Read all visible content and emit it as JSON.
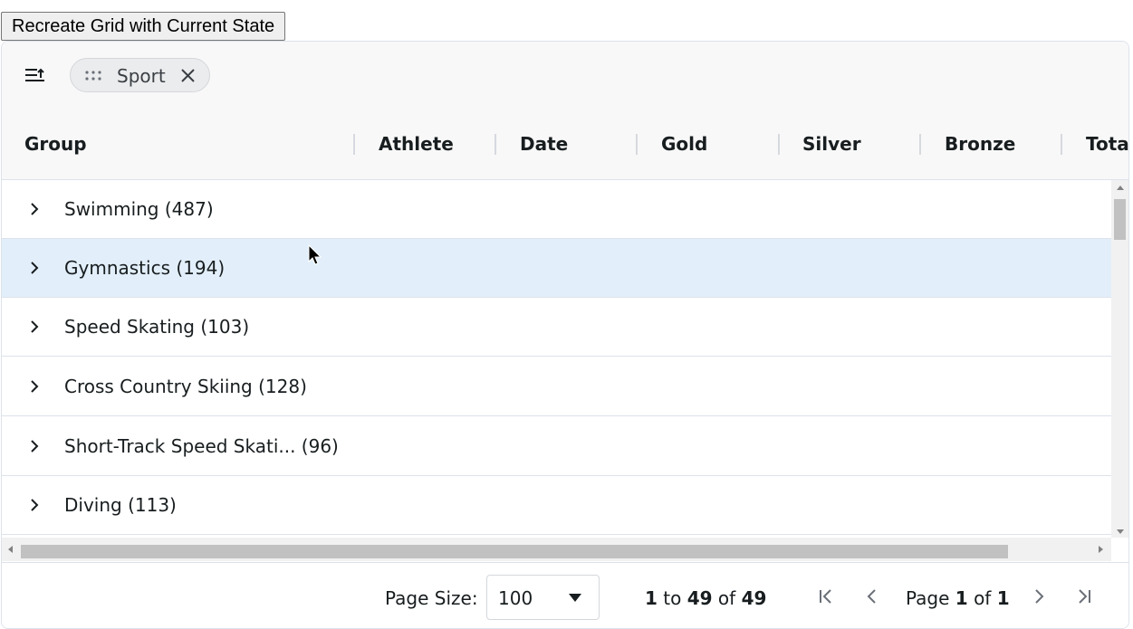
{
  "recreate_button_label": "Recreate Grid with Current State",
  "group_panel": {
    "chip_label": "Sport"
  },
  "columns": [
    {
      "label": "Group"
    },
    {
      "label": "Athlete"
    },
    {
      "label": "Date"
    },
    {
      "label": "Gold"
    },
    {
      "label": "Silver"
    },
    {
      "label": "Bronze"
    },
    {
      "label": "Total"
    }
  ],
  "rows": [
    {
      "label": "Swimming (487)"
    },
    {
      "label": "Gymnastics (194)"
    },
    {
      "label": "Speed Skating (103)"
    },
    {
      "label": "Cross Country Skiing (128)"
    },
    {
      "label": "Short-Track Speed Skati... (96)"
    },
    {
      "label": "Diving (113)"
    }
  ],
  "hovered_row": "Gymnastics (194)",
  "paging": {
    "page_size_label": "Page Size:",
    "page_size_value": "100",
    "row_from": "1",
    "row_to_word": "to",
    "row_to": "49",
    "row_of_word": "of",
    "row_total": "49",
    "page_word": "Page",
    "page_current": "1",
    "page_of_word": "of",
    "page_total": "1"
  },
  "colors": {
    "hover_row": "#e2effa",
    "header_bg": "#f8f8f8",
    "border": "#dde2eb"
  }
}
